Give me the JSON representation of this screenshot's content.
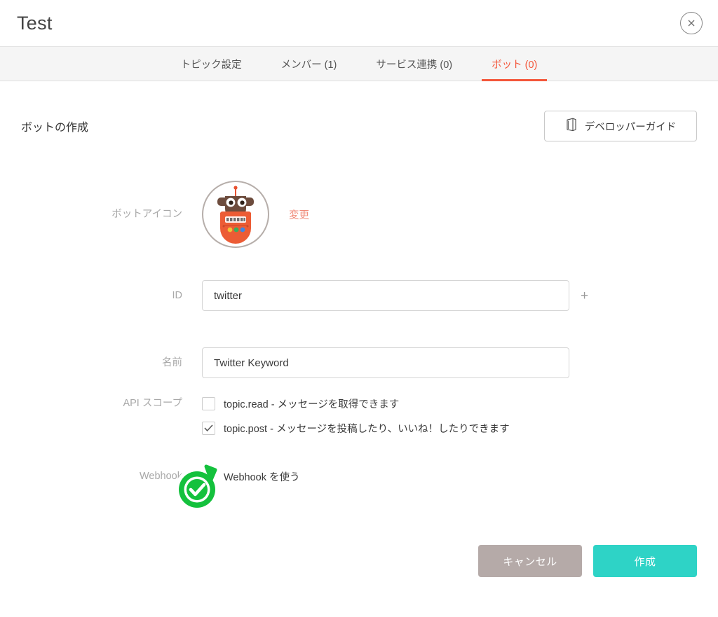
{
  "window": {
    "title": "Test",
    "close_icon": "close-circle-icon"
  },
  "tabs": [
    {
      "label": "トピック設定",
      "active": false
    },
    {
      "label": "メンバー (1)",
      "active": false
    },
    {
      "label": "サービス連携 (0)",
      "active": false
    },
    {
      "label": "ボット (0)",
      "active": true
    }
  ],
  "section": {
    "title": "ボットの作成",
    "guide_button": {
      "label": "デベロッパーガイド",
      "icon": "book-icon"
    }
  },
  "form": {
    "avatar": {
      "label": "ボットアイコン",
      "icon": "robot-avatar-icon",
      "change_link": "変更"
    },
    "id": {
      "label": "ID",
      "value": "twitter",
      "placeholder": "",
      "suffix": "+"
    },
    "name": {
      "label": "名前",
      "value": "Twitter Keyword",
      "placeholder": ""
    },
    "api_scope": {
      "label": "API スコープ",
      "options": [
        {
          "text": "topic.read - メッセージを取得できます",
          "checked": false
        },
        {
          "text": "topic.post - メッセージを投稿したり、いいね！したりできます",
          "checked": true
        }
      ]
    },
    "webhook": {
      "label": "Webhook",
      "option": {
        "text": "Webhook を使う",
        "checked": false
      }
    }
  },
  "footer": {
    "cancel_label": "キャンセル",
    "create_label": "作成"
  },
  "overlay": {
    "cursor_badge_icon": "green-check-cursor-icon"
  },
  "colors": {
    "accent_tab": "#f4563a",
    "change_link": "#f08a78",
    "create_button": "#2ed3c6",
    "cancel_button": "#b5aaa8",
    "badge_green": "#1db954"
  }
}
